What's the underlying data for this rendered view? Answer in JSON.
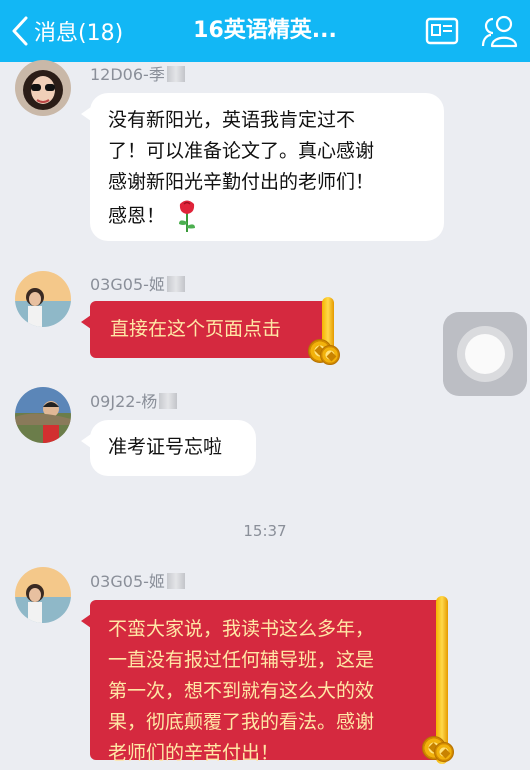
{
  "header": {
    "back_label": "消息(18)",
    "title": "16英语精英...",
    "card_icon": "profile-card-icon",
    "group_icon": "group-members-icon"
  },
  "messages": [
    {
      "sender": "12D06-季",
      "avatar": "avatar-woman-sunglasses",
      "type": "text",
      "lines": [
        "没有新阳光，英语我肯定过不",
        "了！可以准备论文了。真心感谢",
        "感谢新阳光辛勤付出的老师们！",
        "感恩！"
      ],
      "emoji": "rose-icon"
    },
    {
      "sender": "03G05-姬",
      "avatar": "avatar-woman-sunset",
      "type": "red-packet",
      "lines": [
        "直接在这个页面点击"
      ]
    },
    {
      "sender": "09J22-杨",
      "avatar": "avatar-man-landscape",
      "type": "text",
      "lines": [
        "准考证号忘啦"
      ]
    },
    {
      "sender": "03G05-姬",
      "avatar": "avatar-woman-sunset",
      "type": "red-packet",
      "lines": [
        "不蛮大家说，我读书这么多年，",
        "一直没有报过任何辅导班，这是",
        "第一次，想不到就有这么大的效",
        "果，彻底颠覆了我的看法。感谢",
        "老师们的辛苦付出！"
      ]
    }
  ],
  "timestamp": "15:37",
  "colors": {
    "header": "#12b7f5",
    "red_packet": "#d5293f",
    "red_packet_text": "#ffe7a6",
    "background": "#ebedf2"
  }
}
